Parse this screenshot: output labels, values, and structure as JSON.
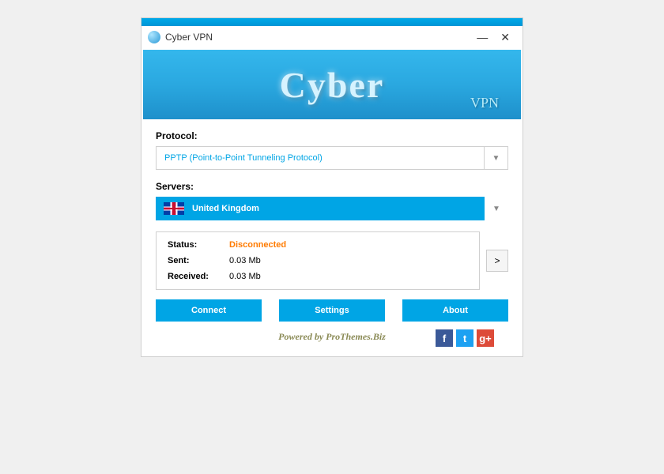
{
  "window": {
    "title": "Cyber VPN"
  },
  "banner": {
    "main": "Cyber",
    "sub": "VPN"
  },
  "protocol": {
    "label": "Protocol:",
    "value": "PPTP (Point-to-Point Tunneling Protocol)"
  },
  "servers": {
    "label": "Servers:",
    "value": "United Kingdom"
  },
  "status": {
    "status_label": "Status:",
    "status_value": "Disconnected",
    "sent_label": "Sent:",
    "sent_value": "0.03 Mb",
    "received_label": "Received:",
    "received_value": "0.03 Mb"
  },
  "side_btn": ">",
  "buttons": {
    "connect": "Connect",
    "settings": "Settings",
    "about": "About"
  },
  "footer": {
    "powered": "Powered by ProThemes.Biz",
    "fb": "f",
    "tw": "t",
    "gp": "g+"
  }
}
